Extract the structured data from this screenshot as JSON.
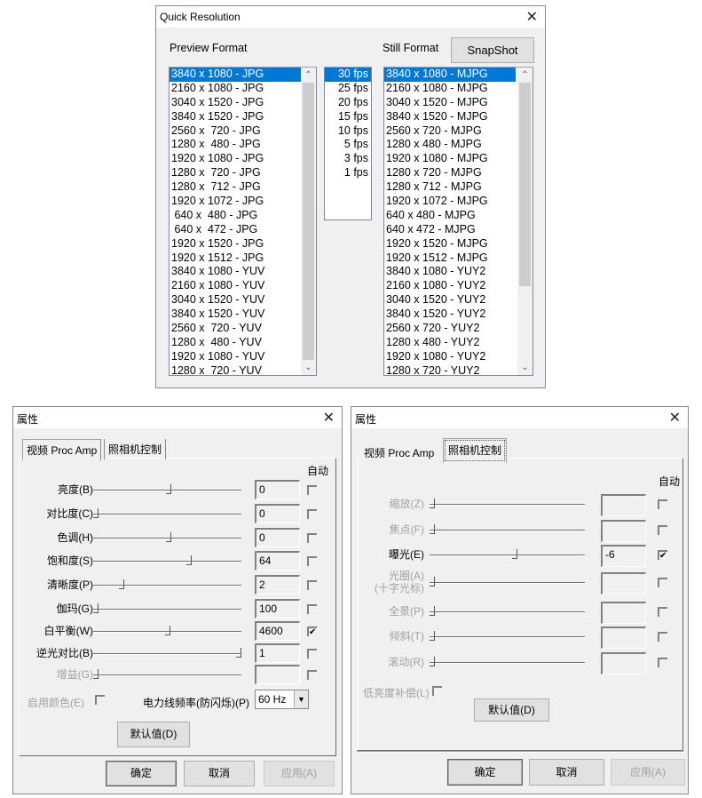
{
  "quick_resolution": {
    "title": "Quick Resolution",
    "close_icon": "close-icon",
    "preview_label": "Preview Format",
    "still_label": "Still Format",
    "snapshot_label": "SnapShot",
    "selected_color": "#0078d7",
    "preview_items": [
      "3840 x 1080 - JPG",
      "2160 x 1080 - JPG",
      "3040 x 1520 - JPG",
      "3840 x 1520 - JPG",
      "2560 x  720 - JPG",
      "1280 x  480 - JPG",
      "1920 x 1080 - JPG",
      "1280 x  720 - JPG",
      "1280 x  712 - JPG",
      "1920 x 1072 - JPG",
      " 640 x  480 - JPG",
      " 640 x  472 - JPG",
      "1920 x 1520 - JPG",
      "1920 x 1512 - JPG",
      "3840 x 1080 - YUV",
      "2160 x 1080 - YUV",
      "3040 x 1520 - YUV",
      "3840 x 1520 - YUV",
      "2560 x  720 - YUV",
      "1280 x  480 - YUV",
      "1920 x 1080 - YUV",
      "1280 x  720 - YUV"
    ],
    "fps_items": [
      "30 fps",
      "25 fps",
      "20 fps",
      "15 fps",
      "10 fps",
      "5 fps",
      "3 fps",
      "1 fps"
    ],
    "still_items": [
      "3840 x 1080 - MJPG",
      "2160 x 1080 - MJPG",
      "3040 x 1520 - MJPG",
      "3840 x 1520 - MJPG",
      "2560 x 720 - MJPG",
      "1280 x 480 - MJPG",
      "1920 x 1080 - MJPG",
      "1280 x 720 - MJPG",
      "1280 x 712 - MJPG",
      "1920 x 1072 - MJPG",
      "640 x 480 - MJPG",
      "640 x 472 - MJPG",
      "1920 x 1520 - MJPG",
      "1920 x 1512 - MJPG",
      "3840 x 1080 - YUY2",
      "2160 x 1080 - YUY2",
      "3040 x 1520 - YUY2",
      "3840 x 1520 - YUY2",
      "2560 x 720 - YUY2",
      "1280 x 480 - YUY2",
      "1920 x 1080 - YUY2",
      "1280 x 720 - YUY2"
    ]
  },
  "proc_amp": {
    "title": "属性",
    "tabs": [
      "视频 Proc Amp",
      "照相机控制"
    ],
    "auto_label": "自动",
    "rows": [
      {
        "label": "亮度(B)",
        "value": "0",
        "slider": 0.51,
        "auto": false,
        "enabled": true
      },
      {
        "label": "对比度(C)",
        "value": "0",
        "slider": 0,
        "auto": false,
        "enabled": true
      },
      {
        "label": "色调(H)",
        "value": "0",
        "slider": 0.51,
        "auto": false,
        "enabled": true
      },
      {
        "label": "饱和度(S)",
        "value": "64",
        "slider": 0.65,
        "auto": false,
        "enabled": true
      },
      {
        "label": "清晰度(P)",
        "value": "2",
        "slider": 0.18,
        "auto": false,
        "enabled": true
      },
      {
        "label": "伽玛(G)",
        "value": "100",
        "slider": 0,
        "auto": false,
        "enabled": true
      },
      {
        "label": "白平衡(W)",
        "value": "4600",
        "slider": 0.5,
        "auto": true,
        "enabled": true
      },
      {
        "label": "逆光对比(B)",
        "value": "1",
        "slider": 1,
        "auto": false,
        "enabled": true
      },
      {
        "label": "增益(G)",
        "value": "",
        "slider": 0,
        "auto": false,
        "enabled": false
      }
    ],
    "color_enable_label": "启用颜色(E)",
    "powerline_label": "电力线频率(防闪烁)(P)",
    "powerline_value": "60 Hz",
    "default_label": "默认值(D)",
    "ok_label": "确定",
    "cancel_label": "取消",
    "apply_label": "应用(A)"
  },
  "camera_control": {
    "title": "属性",
    "tabs": [
      "视频 Proc Amp",
      "照相机控制"
    ],
    "auto_label": "自动",
    "rows": [
      {
        "label": "缩放(Z)",
        "value": "",
        "slider": 0,
        "auto": false,
        "enabled": false
      },
      {
        "label": "焦点(F)",
        "value": "",
        "slider": 0,
        "auto": false,
        "enabled": false
      },
      {
        "label": "曝光(E)",
        "value": "-6",
        "slider": 0.55,
        "auto": true,
        "enabled": true
      },
      {
        "label": "光圈(A)\n(十字光标)",
        "value": "",
        "slider": 0,
        "auto": false,
        "enabled": false
      },
      {
        "label": "全景(P)",
        "value": "",
        "slider": 0,
        "auto": false,
        "enabled": false
      },
      {
        "label": "倾斜(T)",
        "value": "",
        "slider": 0,
        "auto": false,
        "enabled": false
      },
      {
        "label": "滚动(R)",
        "value": "",
        "slider": 0,
        "auto": false,
        "enabled": false
      }
    ],
    "low_light_label": "低亮度补偿(L)",
    "default_label": "默认值(D)",
    "ok_label": "确定",
    "cancel_label": "取消",
    "apply_label": "应用(A)"
  }
}
